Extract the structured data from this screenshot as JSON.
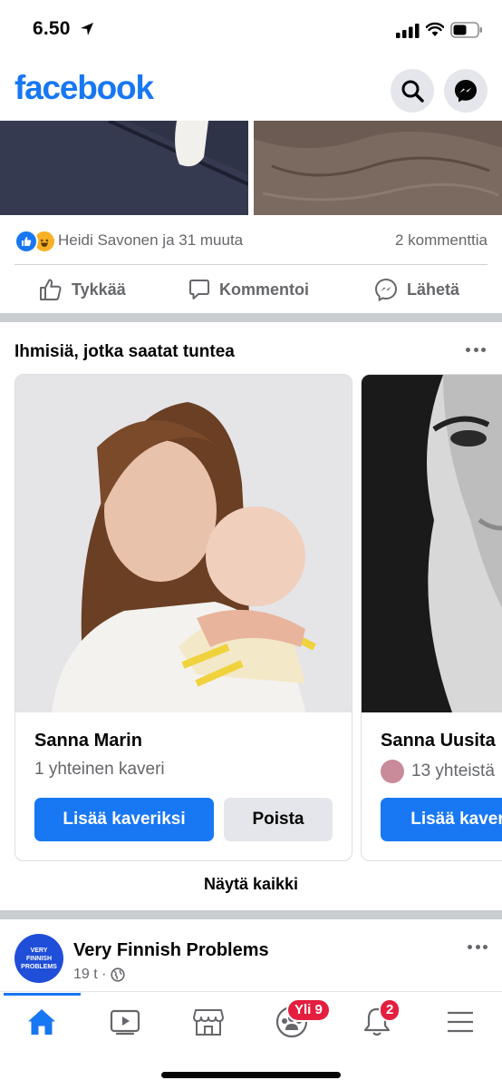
{
  "status_bar": {
    "time": "6.50"
  },
  "header": {
    "logo": "facebook"
  },
  "post": {
    "reactors": "Heidi Savonen ja 31 muuta",
    "comments": "2 kommenttia",
    "actions": {
      "like": "Tykkää",
      "comment": "Kommentoi",
      "send": "Lähetä"
    }
  },
  "pymk": {
    "title": "Ihmisiä, jotka saatat tuntea",
    "cards": [
      {
        "name": "Sanna Marin",
        "mutual": "1 yhteinen kaveri",
        "add": "Lisää kaveriksi",
        "remove": "Poista"
      },
      {
        "name": "Sanna Uusita",
        "mutual": "13 yhteistä",
        "add": "Lisää kaver"
      }
    ],
    "see_all": "Näytä kaikki"
  },
  "page_post": {
    "avatar_text": "VERY FINNISH PROBLEMS",
    "name": "Very Finnish Problems",
    "time": "19 t ·"
  },
  "tabbar": {
    "badges": {
      "groups": "Yli 9",
      "notifications": "2"
    },
    "tabs": [
      "home-icon",
      "watch-icon",
      "marketplace-icon",
      "groups-icon",
      "bell-icon",
      "menu-icon"
    ]
  },
  "colors": {
    "brand": "#1877f2",
    "badge": "#e41e3f"
  }
}
